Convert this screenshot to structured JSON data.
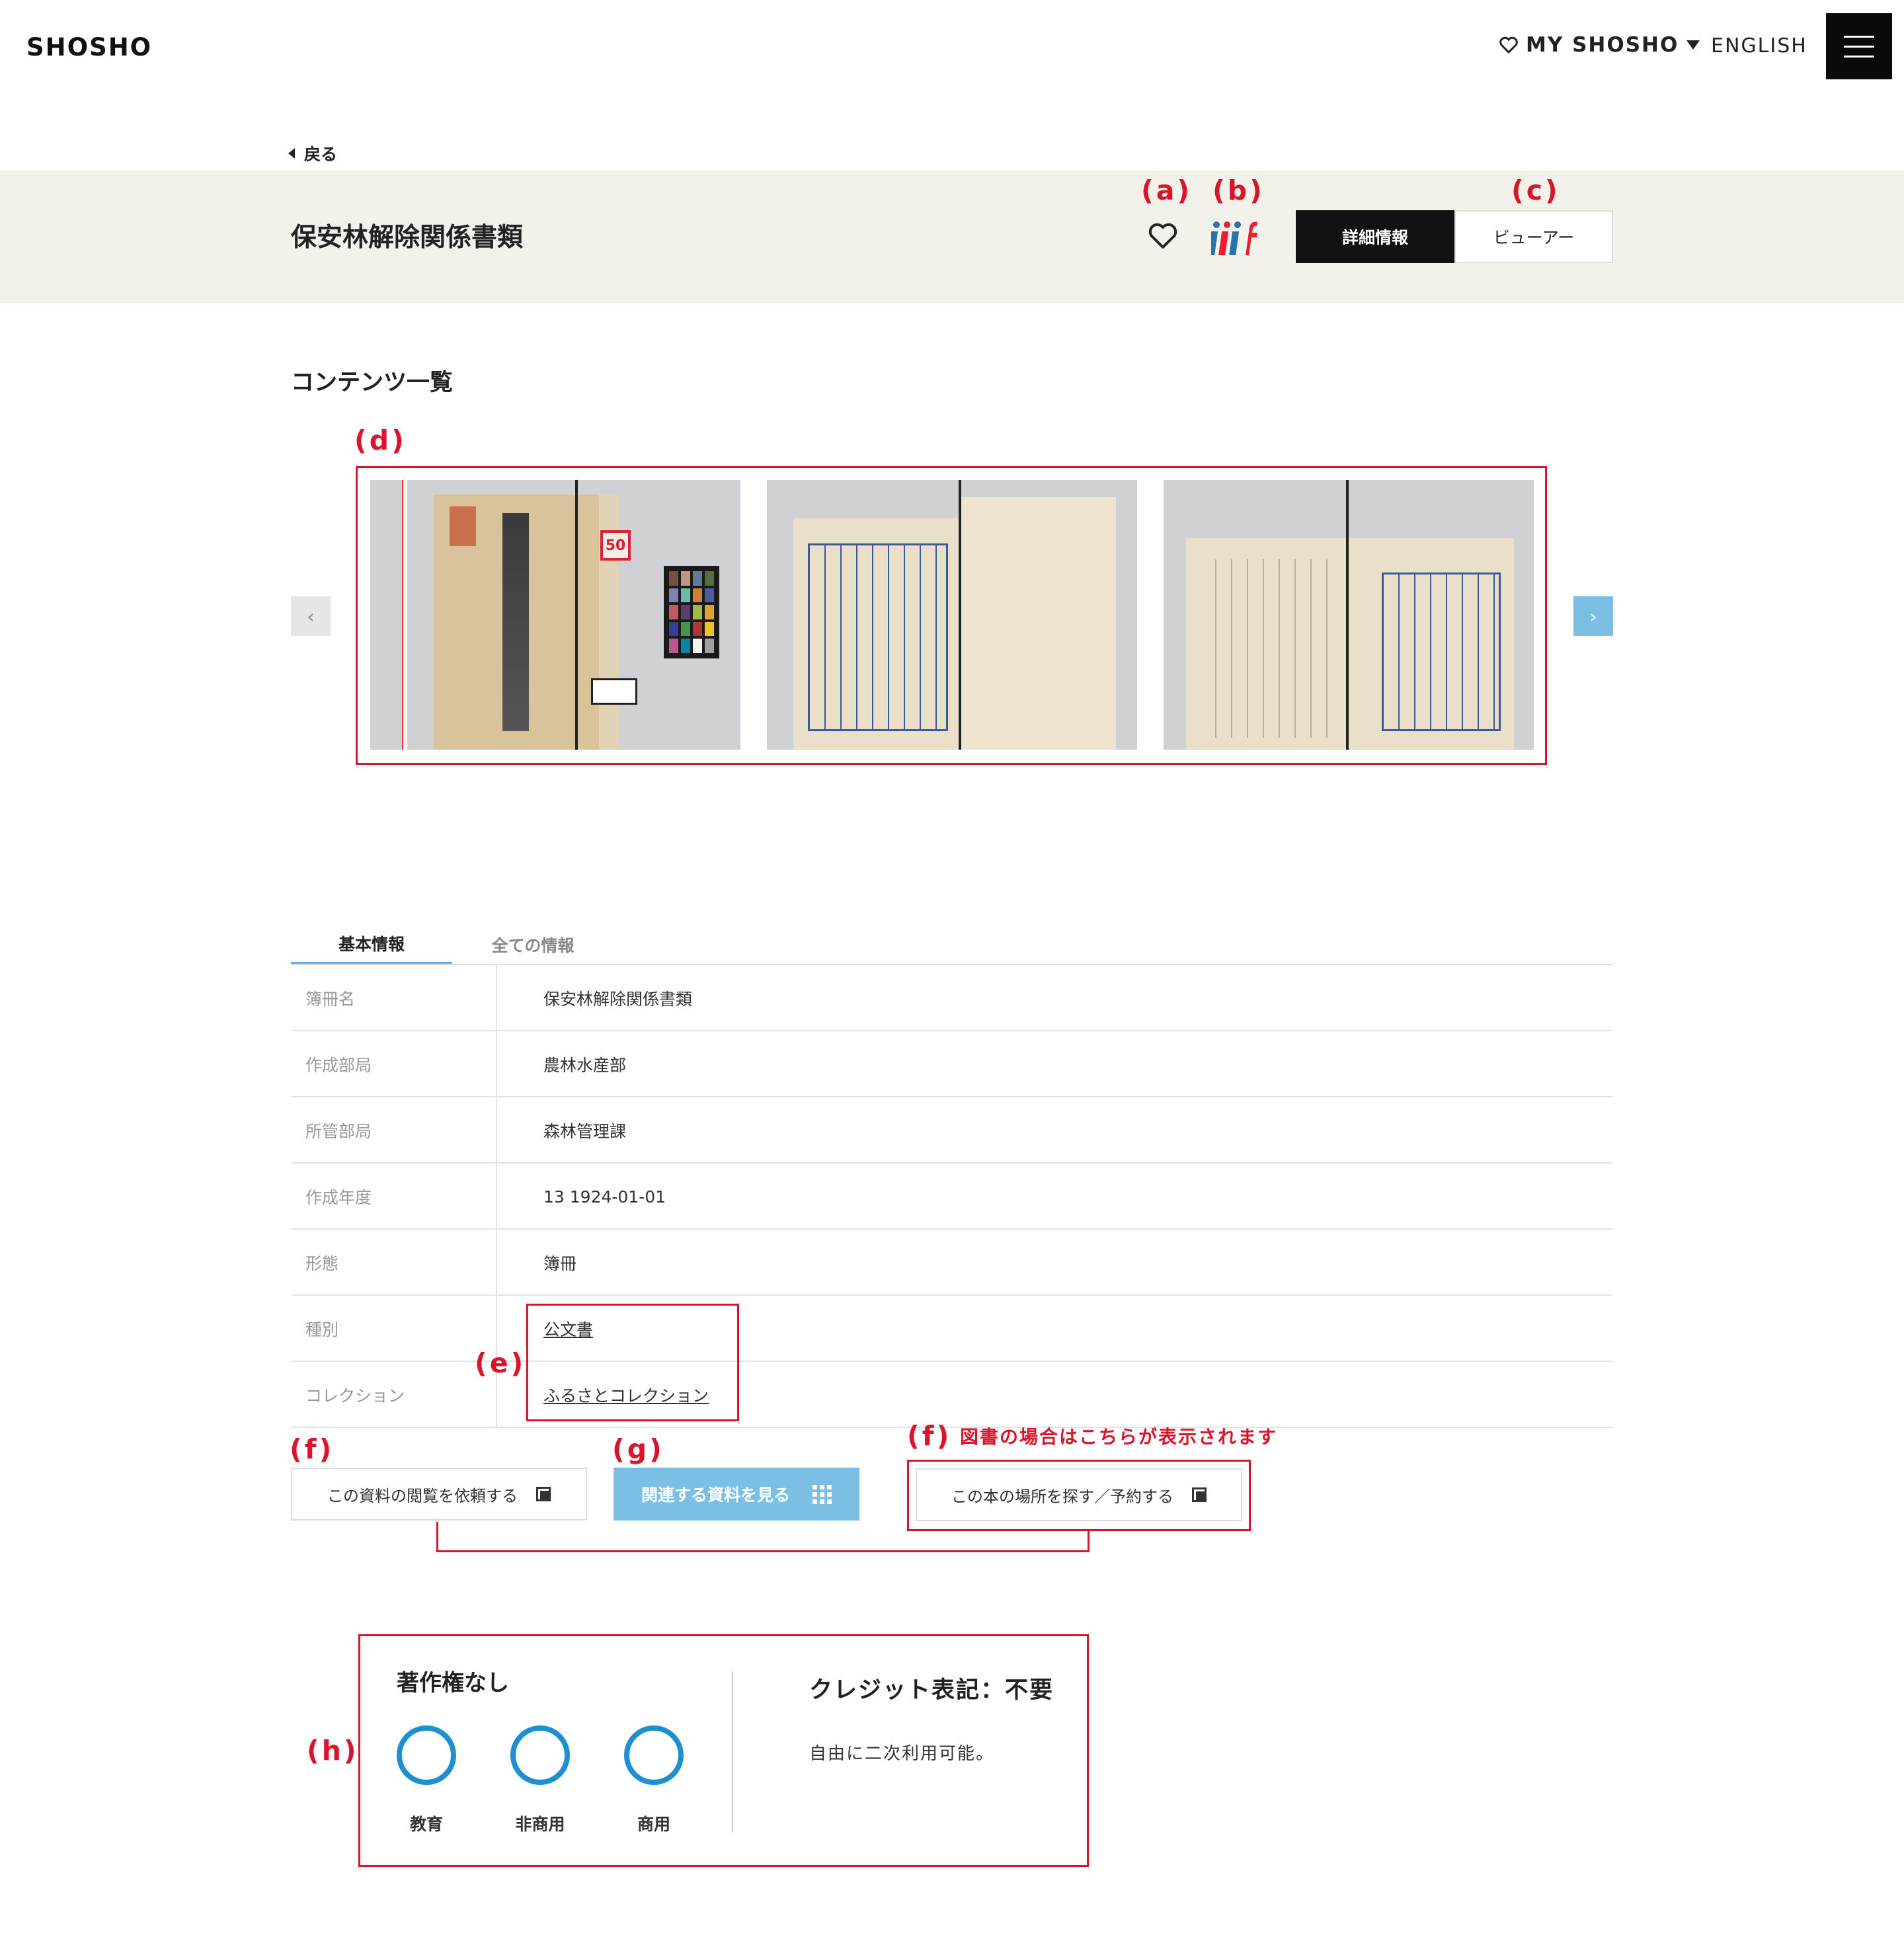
{
  "header": {
    "logo": "SHOSHO",
    "my_shosho": "MY SHOSHO",
    "language": "ENGLISH"
  },
  "nav": {
    "back": "戻る"
  },
  "record": {
    "title": "保安林解除関係書類",
    "tabs": {
      "detail": "詳細情報",
      "viewer": "ビューアー"
    }
  },
  "contents": {
    "heading": "コンテンツ一覧"
  },
  "info_tabs": {
    "basic": "基本情報",
    "all": "全ての情報"
  },
  "fields": [
    {
      "key": "簿冊名",
      "value": "保安林解除関係書類"
    },
    {
      "key": "作成部局",
      "value": "農林水産部"
    },
    {
      "key": "所管部局",
      "value": "森林管理課"
    },
    {
      "key": "作成年度",
      "value": "13 1924-01-01"
    },
    {
      "key": "形態",
      "value": "簿冊"
    },
    {
      "key": "種別",
      "value": "公文書"
    },
    {
      "key": "コレクション",
      "value": "ふるさとコレクション"
    }
  ],
  "actions": {
    "request_view": "この資料の閲覧を依頼する",
    "related": "関連する資料を見る",
    "find_book": "この本の場所を探す／予約する"
  },
  "rights": {
    "title": "著作権なし",
    "uses": [
      "教育",
      "非商用",
      "商用"
    ],
    "credit": "クレジット表記：不要",
    "credit_desc": "自由に二次利用可能。"
  },
  "annotations": {
    "a": "(a)",
    "b": "(b)",
    "c": "(c)",
    "d": "(d)",
    "e": "(e)",
    "f1": "(f)",
    "f2": "(f)",
    "f_note": "図書の場合はこちらが表示されます",
    "g": "(g)",
    "h": "(h)"
  },
  "colors": {
    "accent": "#7cbfe5",
    "annotation": "#d9142b",
    "band": "#f2f1ea",
    "circle": "#1e90d0"
  }
}
